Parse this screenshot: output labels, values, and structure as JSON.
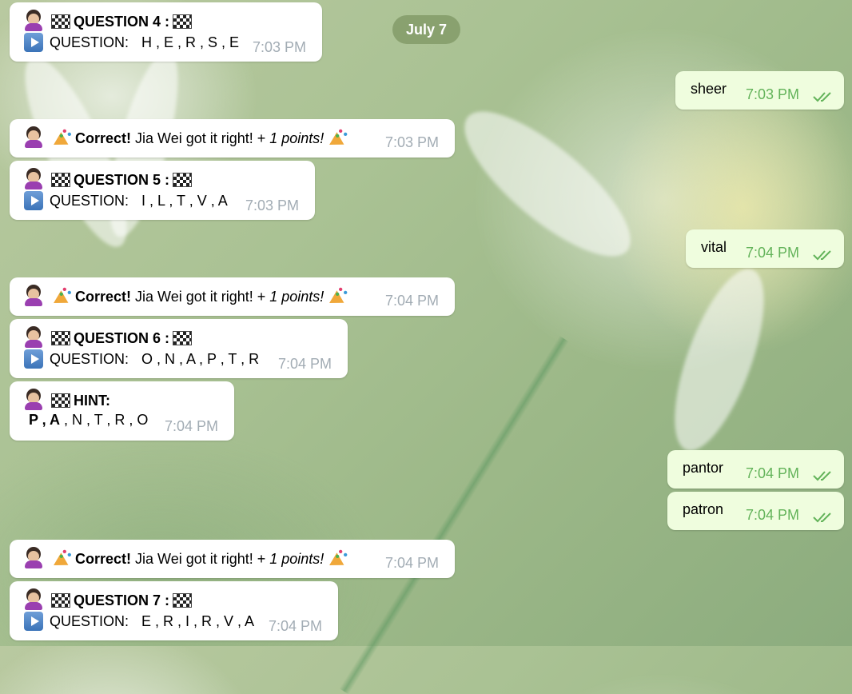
{
  "date_pill": "July 7",
  "incoming": [
    {
      "title": "QUESTION 4 :",
      "prefix": "QUESTION:",
      "letters": "H , E , R , S , E",
      "time": "7:03 PM"
    },
    {
      "correct_label": "Correct!",
      "text": "Jia Wei got it right! +",
      "points": "1 points!",
      "time": "7:03 PM"
    },
    {
      "title": "QUESTION 5 :",
      "prefix": "QUESTION:",
      "letters": "I , L , T , V , A",
      "time": "7:03 PM"
    },
    {
      "correct_label": "Correct!",
      "text": "Jia Wei got it right! +",
      "points": "1 points!",
      "time": "7:04 PM"
    },
    {
      "title": "QUESTION 6 :",
      "prefix": "QUESTION:",
      "letters": "O , N , A , P , T , R",
      "time": "7:04 PM"
    },
    {
      "title": "HINT:",
      "hint_bold": "P , A",
      "hint_rest": " , N , T , R , O",
      "time": "7:04 PM"
    },
    {
      "correct_label": "Correct!",
      "text": "Jia Wei got it right! +",
      "points": "1 points!",
      "time": "7:04 PM"
    },
    {
      "title": "QUESTION 7 :",
      "prefix": "QUESTION:",
      "letters": "E , R , I , R , V , A",
      "time": "7:04 PM"
    }
  ],
  "outgoing": [
    {
      "text": "sheer",
      "time": "7:03 PM"
    },
    {
      "text": "vital",
      "time": "7:04 PM"
    },
    {
      "text": "pantor",
      "time": "7:04 PM"
    },
    {
      "text": "patron",
      "time": "7:04 PM"
    }
  ],
  "icons": {
    "person": "woman-tipping-hand-icon",
    "flag": "chequered-flag-icon",
    "play": "play-button-icon",
    "party": "party-popper-icon",
    "read": "double-check-icon"
  },
  "colors": {
    "incoming_bubble": "#ffffff",
    "outgoing_bubble": "#effdde",
    "time_incoming": "#a2acb4",
    "time_outgoing": "#63b35a",
    "date_pill": "#829b69"
  }
}
